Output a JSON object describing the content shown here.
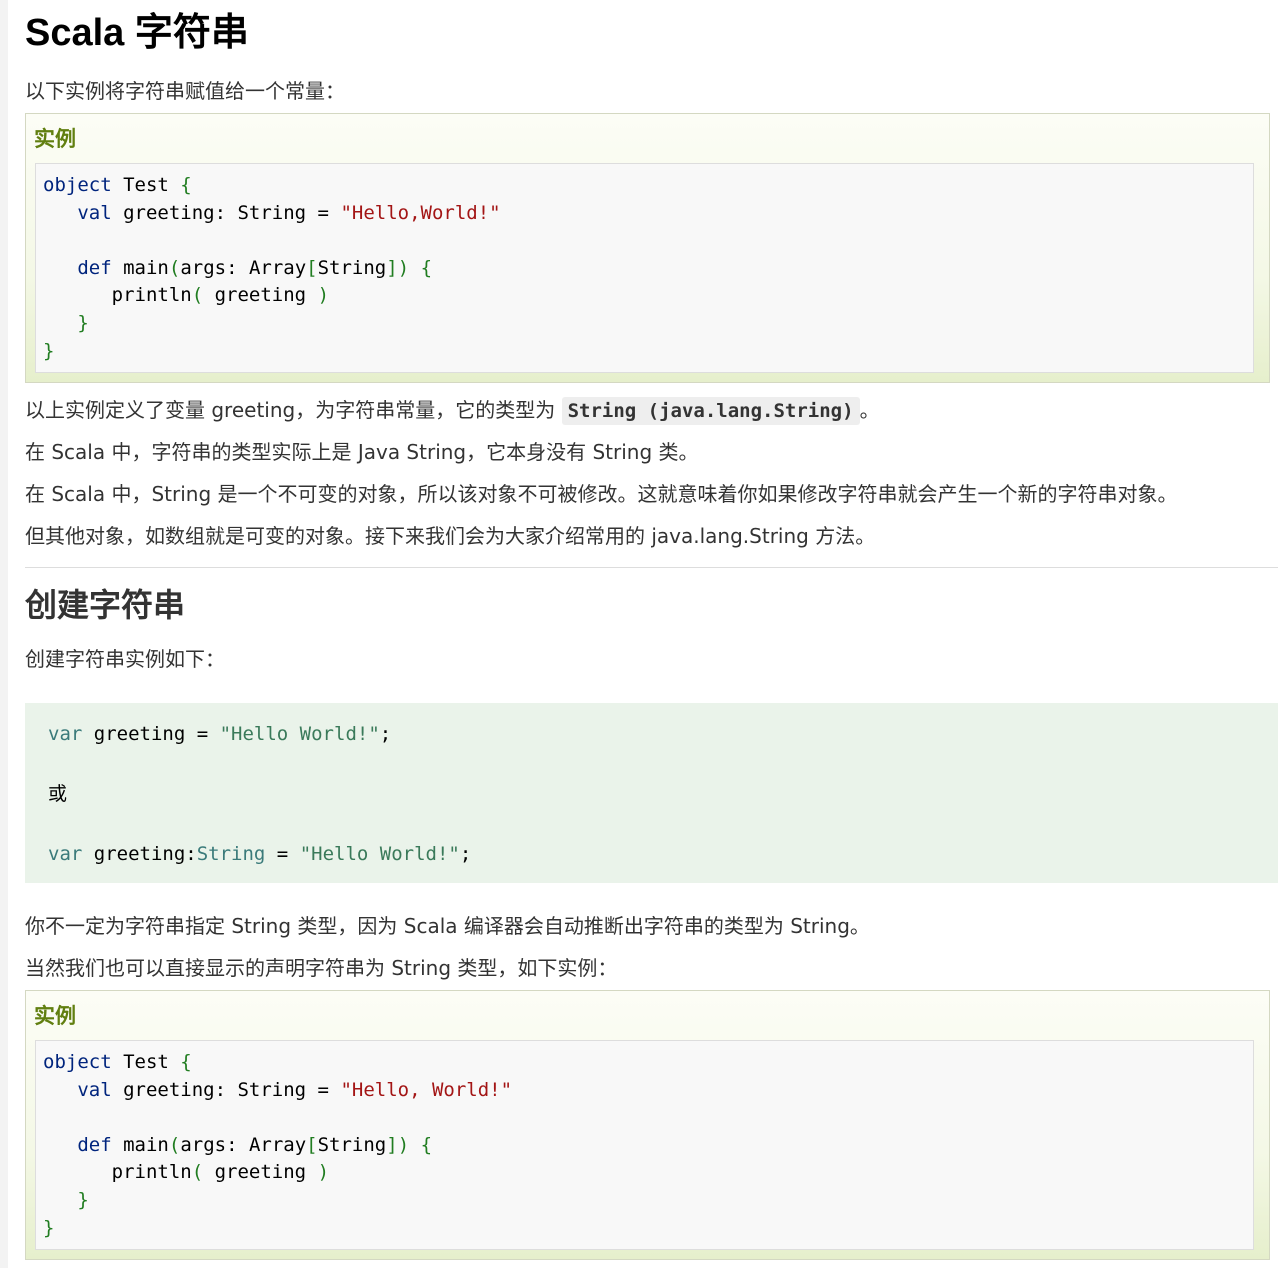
{
  "title": "Scala 字符串",
  "intro": "以下实例将字符串赋值给一个常量：",
  "example1": {
    "label": "实例",
    "lines": [
      {
        "kw": "object",
        "rest": " Test "
      },
      {
        "indent": "   ",
        "kw": "val",
        "mid": " greeting: String = ",
        "str": "\"Hello,World!\""
      },
      {},
      {
        "indent": "   ",
        "kw": "def",
        "mid": " main(args: Array[String]) "
      },
      {
        "indent": "      ",
        "mid": "println( greeting )"
      },
      {
        "indent": "   "
      },
      {}
    ]
  },
  "para1_prefix": "以上实例定义了变量 greeting，为字符串常量，它的类型为 ",
  "para1_code": "String (java.lang.String)",
  "para1_suffix": "。",
  "para2": "在 Scala 中，字符串的类型实际上是 Java String，它本身没有 String 类。",
  "para3": "在 Scala 中，String 是一个不可变的对象，所以该对象不可被修改。这就意味着你如果修改字符串就会产生一个新的字符串对象。",
  "para4": "但其他对象，如数组就是可变的对象。接下来我们会为大家介绍常用的 java.lang.String 方法。",
  "section2": {
    "heading": "创建字符串",
    "intro": "创建字符串实例如下：",
    "code_line1_kw": "var",
    "code_line1_mid": " greeting = ",
    "code_line1_str": "\"Hello World!\"",
    "code_line1_end": ";",
    "code_or": "或",
    "code_line2_kw": "var",
    "code_line2_mid": " greeting:",
    "code_line2_type": "String",
    "code_line2_eq": " = ",
    "code_line2_str": "\"Hello World!\"",
    "code_line2_end": ";"
  },
  "para5": "你不一定为字符串指定 String 类型，因为 Scala 编译器会自动推断出字符串的类型为 String。",
  "para6": "当然我们也可以直接显示的声明字符串为 String 类型，如下实例：",
  "example2": {
    "label": "实例",
    "str": "\"Hello, World!\""
  }
}
